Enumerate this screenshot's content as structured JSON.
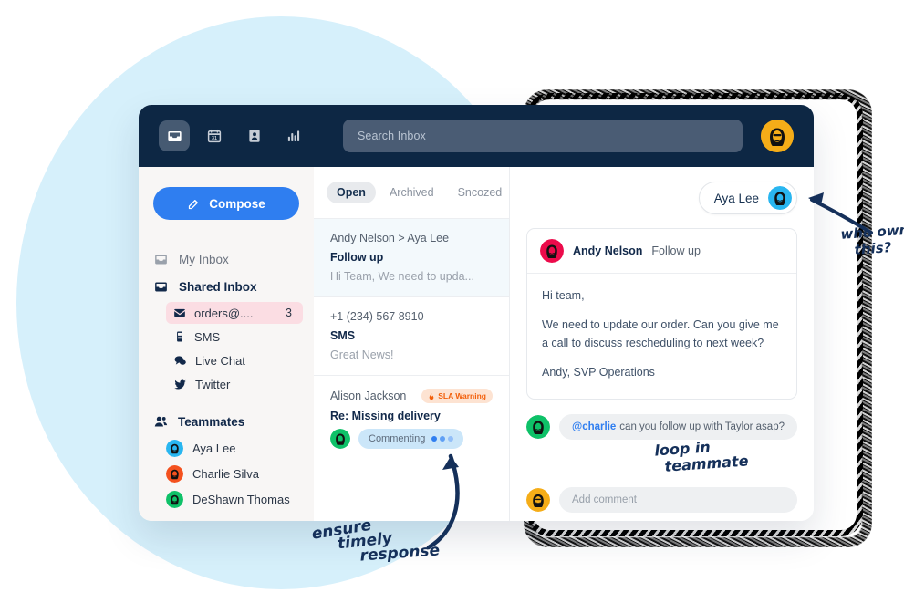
{
  "topbar": {
    "icons": [
      {
        "name": "inbox-icon",
        "label": "Inbox",
        "active": true
      },
      {
        "name": "calendar-icon",
        "label": "Calendar",
        "active": false
      },
      {
        "name": "contacts-icon",
        "label": "Contacts",
        "active": false
      },
      {
        "name": "analytics-icon",
        "label": "Analytics",
        "active": false
      }
    ],
    "search_placeholder": "Search Inbox",
    "avatar_name": "account-avatar",
    "bg_color": "#0d2744",
    "avatar_color": "#f5ad18"
  },
  "sidebar": {
    "compose_label": "Compose",
    "compose_color": "#2f7ef0",
    "my_inbox_label": "My Inbox",
    "shared_inbox_label": "Shared Inbox",
    "channels": [
      {
        "label": "orders@....",
        "count": "3",
        "icon": "envelope-icon",
        "highlight": true,
        "highlight_color": "#fbdde3"
      },
      {
        "label": "SMS",
        "count": "",
        "icon": "mobile-icon",
        "highlight": false
      },
      {
        "label": "Live Chat",
        "count": "",
        "icon": "chat-icon",
        "highlight": false
      },
      {
        "label": "Twitter",
        "count": "",
        "icon": "twitter-icon",
        "highlight": false
      }
    ],
    "teammates_label": "Teammates",
    "teammates": [
      {
        "name": "Aya Lee",
        "color": "#29b6f0"
      },
      {
        "name": "Charlie Silva",
        "color": "#f4511e"
      },
      {
        "name": "DeShawn Thomas",
        "color": "#0ec168"
      }
    ]
  },
  "conversations": {
    "tabs": [
      {
        "label": "Open",
        "active": true
      },
      {
        "label": "Archived",
        "active": false
      },
      {
        "label": "Sncozed",
        "active": false
      }
    ],
    "items": [
      {
        "from": "Andy Nelson > Aya Lee",
        "subject": "Follow up",
        "preview": "Hi Team, We need to upda...",
        "selected": true,
        "badge": "",
        "status": ""
      },
      {
        "from": "+1 (234) 567 8910",
        "subject": "SMS",
        "preview": "Great News!",
        "selected": false,
        "badge": "",
        "status": ""
      },
      {
        "from": "Alison Jackson",
        "subject": "Re: Missing delivery",
        "preview": "",
        "selected": false,
        "badge": "SLA Warning",
        "badge_icon": "flame-icon",
        "badge_color": "#f2600c",
        "status": "Commenting",
        "status_avatar_color": "#0ec168"
      }
    ]
  },
  "message": {
    "assignee": "Aya Lee",
    "assignee_avatar_color": "#29b6f0",
    "sender": "Andy Nelson",
    "sender_avatar_color": "#ec0b4b",
    "subject": "Follow up",
    "body": [
      "Hi team,",
      "We need to update our order. Can you give me a call to discuss rescheduling to next week?",
      "Andy, SVP Operations"
    ],
    "comment": {
      "mention": "@charlie",
      "text": "can you follow up with Taylor asap?",
      "avatar_color": "#0ec168"
    },
    "comment_input_placeholder": "Add comment",
    "comment_input_avatar_color": "#f5ad18"
  },
  "annotations": {
    "ensure": [
      "ensure",
      "timely",
      "response"
    ],
    "loop": [
      "loop in",
      "teammate"
    ],
    "owns": [
      "who owns",
      "this?"
    ]
  }
}
